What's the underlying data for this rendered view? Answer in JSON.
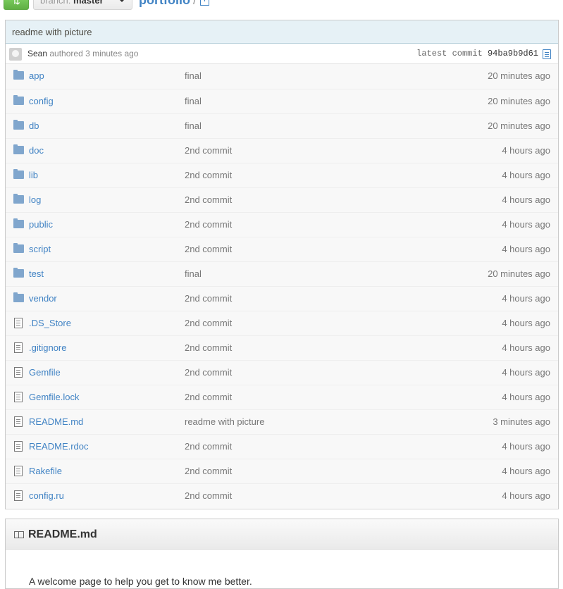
{
  "topbar": {
    "compare_glyph": "⇅",
    "branch_label": "branch:",
    "branch_name": "master",
    "repo_name": "portfolio",
    "separator": "/",
    "new_file_glyph": "+"
  },
  "commit": {
    "message": "readme with picture",
    "author": "Sean",
    "authored_text": "authored 3 minutes ago",
    "latest_label": "latest commit",
    "sha": "94ba9b9d61"
  },
  "files": [
    {
      "name": "app",
      "type": "dir",
      "message": "final",
      "age": "20 minutes ago"
    },
    {
      "name": "config",
      "type": "dir",
      "message": "final",
      "age": "20 minutes ago"
    },
    {
      "name": "db",
      "type": "dir",
      "message": "final",
      "age": "20 minutes ago"
    },
    {
      "name": "doc",
      "type": "dir",
      "message": "2nd commit",
      "age": "4 hours ago"
    },
    {
      "name": "lib",
      "type": "dir",
      "message": "2nd commit",
      "age": "4 hours ago"
    },
    {
      "name": "log",
      "type": "dir",
      "message": "2nd commit",
      "age": "4 hours ago"
    },
    {
      "name": "public",
      "type": "dir",
      "message": "2nd commit",
      "age": "4 hours ago"
    },
    {
      "name": "script",
      "type": "dir",
      "message": "2nd commit",
      "age": "4 hours ago"
    },
    {
      "name": "test",
      "type": "dir",
      "message": "final",
      "age": "20 minutes ago"
    },
    {
      "name": "vendor",
      "type": "dir",
      "message": "2nd commit",
      "age": "4 hours ago"
    },
    {
      "name": ".DS_Store",
      "type": "file",
      "message": "2nd commit",
      "age": "4 hours ago"
    },
    {
      "name": ".gitignore",
      "type": "file",
      "message": "2nd commit",
      "age": "4 hours ago"
    },
    {
      "name": "Gemfile",
      "type": "file",
      "message": "2nd commit",
      "age": "4 hours ago"
    },
    {
      "name": "Gemfile.lock",
      "type": "file",
      "message": "2nd commit",
      "age": "4 hours ago"
    },
    {
      "name": "README.md",
      "type": "file",
      "message": "readme with picture",
      "age": "3 minutes ago"
    },
    {
      "name": "README.rdoc",
      "type": "file",
      "message": "2nd commit",
      "age": "4 hours ago"
    },
    {
      "name": "Rakefile",
      "type": "file",
      "message": "2nd commit",
      "age": "4 hours ago"
    },
    {
      "name": "config.ru",
      "type": "file",
      "message": "2nd commit",
      "age": "4 hours ago"
    }
  ],
  "readme": {
    "title": "README.md",
    "body": "A welcome page to help you get to know me better."
  }
}
